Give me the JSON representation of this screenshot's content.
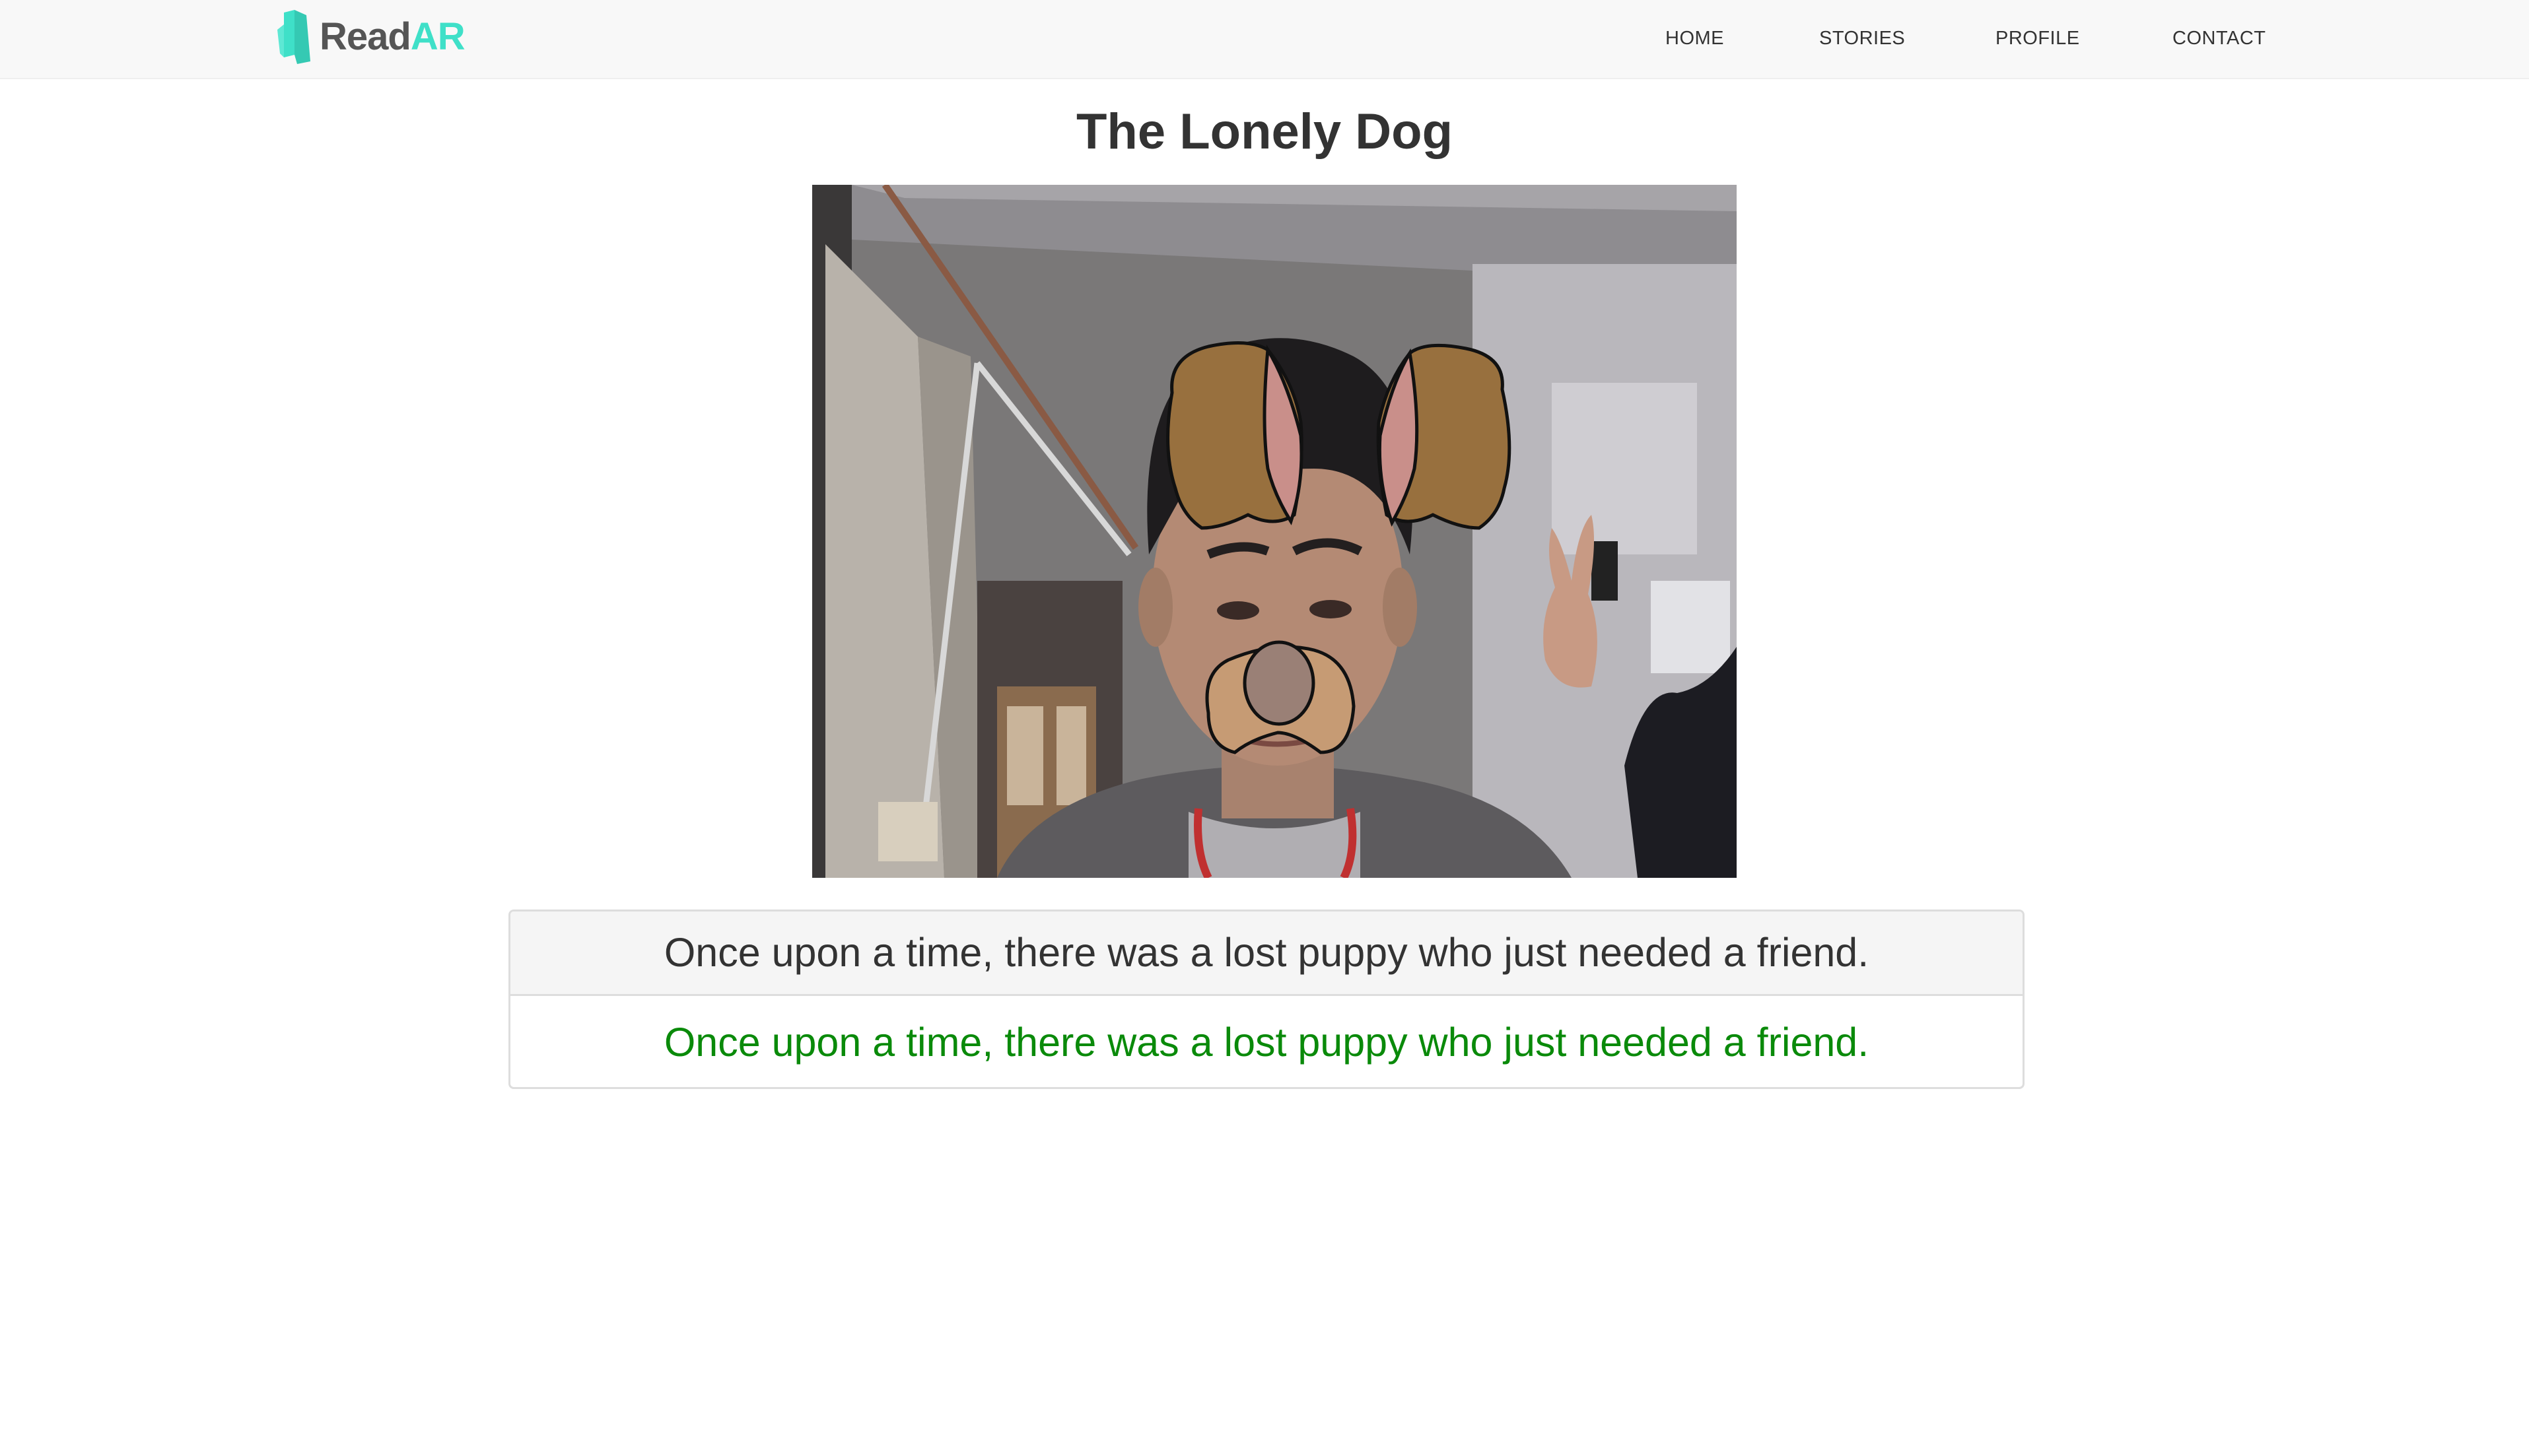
{
  "brand": {
    "name_part1": "Read",
    "name_part2": "AR",
    "accent_color": "#3fe0c8"
  },
  "nav": {
    "items": [
      {
        "label": "HOME"
      },
      {
        "label": "STORIES"
      },
      {
        "label": "PROFILE"
      },
      {
        "label": "CONTACT"
      }
    ]
  },
  "story": {
    "title": "The Lonely Dog",
    "camera_overlay": "dog-face-filter",
    "sentence_prompt": "Once upon a time, there was a lost puppy who just needed a friend.",
    "sentence_spoken": "Once upon a time, there was a lost puppy who just needed a friend.",
    "spoken_color": "#0a8a0a"
  }
}
